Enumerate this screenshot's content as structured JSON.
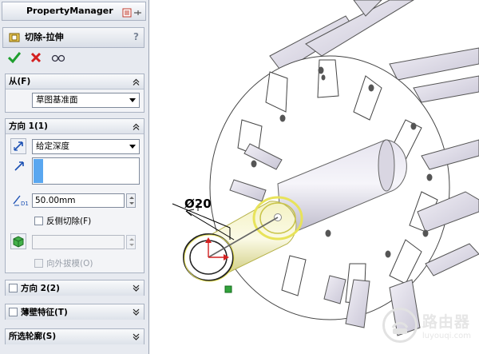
{
  "panel": {
    "title": "PropertyManager",
    "feature_name": "切除-拉伸",
    "help": "?",
    "actions": [
      "ok-check-icon",
      "cancel-x-icon",
      "detailed-preview-icon"
    ],
    "from": {
      "header": "从(F)",
      "select_value": "草图基准面"
    },
    "direction1": {
      "header": "方向 1(1)",
      "end_condition": "给定深度",
      "depth_value": "50.00mm",
      "flip_side_label": "反侧切除(F)",
      "draft_outward_label": "向外拔模(O)"
    },
    "collapsed_groups": [
      {
        "label": "方向 2(2)",
        "checkbox": true
      },
      {
        "label": "薄壁特征(T)",
        "checkbox": true
      },
      {
        "label": "所选轮廓(S)",
        "checkbox": false
      }
    ]
  },
  "graphics": {
    "dimension_text": "Ø20",
    "watermark_cn": "路由器",
    "watermark_en": "luyouqi.com"
  },
  "colors": {
    "panel_bg": "#e7eaf0",
    "preview_yellow": "#e8e35a",
    "ok_green": "#1e9e2e",
    "cancel_red": "#d42020"
  }
}
